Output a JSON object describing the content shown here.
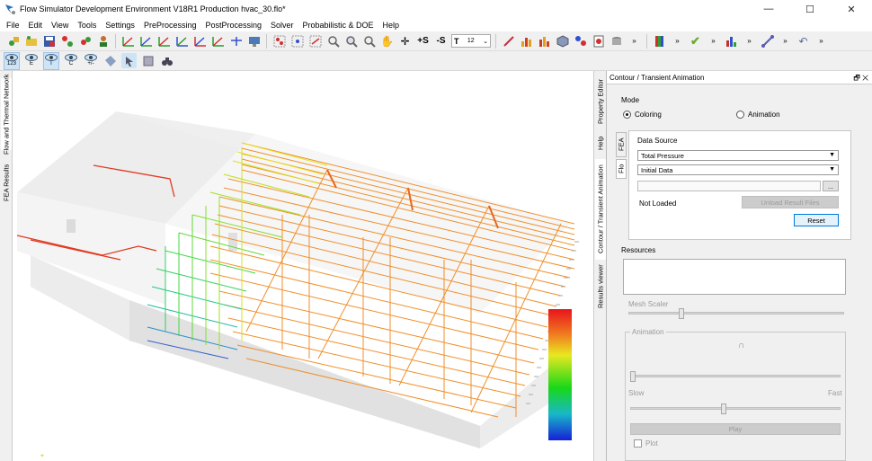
{
  "window": {
    "title": "Flow Simulator Development Environment V18R1 Production hvac_30.flo*",
    "minimize": "—",
    "maximize": "☐",
    "close": "✕"
  },
  "menu": [
    "File",
    "Edit",
    "View",
    "Tools",
    "Settings",
    "PreProcessing",
    "PostProcessing",
    "Solver",
    "Probabilistic & DOE",
    "Help"
  ],
  "toolbar": {
    "text_size_value": "12",
    "text_size_prefix": "T",
    "icons": [
      "open-icon",
      "save-icon",
      "node-icon",
      "axis-x-icon",
      "axis-y-icon",
      "pan-icon",
      "zoom-icon",
      "chart-icon",
      "cube-icon",
      "check-icon",
      "settings-icon"
    ]
  },
  "view_toolbar": {
    "buttons": [
      {
        "label": "123",
        "name": "show-numbers"
      },
      {
        "label": "E",
        "name": "show-elements"
      },
      {
        "label": "T",
        "name": "show-text"
      },
      {
        "label": "C",
        "name": "show-chambers"
      },
      {
        "label": "+/-",
        "name": "show-plusminus"
      }
    ]
  },
  "left_tabs": [
    "FEA Results",
    "Flow and Thermal Network"
  ],
  "right_tabs": [
    "Property Editor",
    "Help",
    "Contour / Transient Animation",
    "Results viewer"
  ],
  "panel": {
    "title": "Contour / Transient Animation",
    "header_buttons": "🗗 ✕",
    "mode_label": "Mode",
    "mode_coloring": "Coloring",
    "mode_animation": "Animation",
    "side_tabs": [
      "FEA",
      "Flo"
    ],
    "data_source_label": "Data Source",
    "data_source_value": "Total Pressure",
    "data_set_value": "Initial Data",
    "browse_button": "...",
    "status": "Not Loaded",
    "unload_button": "Unload Result Files",
    "reset_button": "Reset",
    "resources_label": "Resources",
    "mesh_scaler_label": "Mesh Scaler",
    "animation_label": "Animation",
    "slow_label": "Slow",
    "fast_label": "Fast",
    "play_button": "Play",
    "plot_label": "Plot"
  },
  "colors": {
    "legend_top": "#e8141c",
    "legend_mid": "#18d818",
    "legend_bottom": "#1620d6"
  }
}
